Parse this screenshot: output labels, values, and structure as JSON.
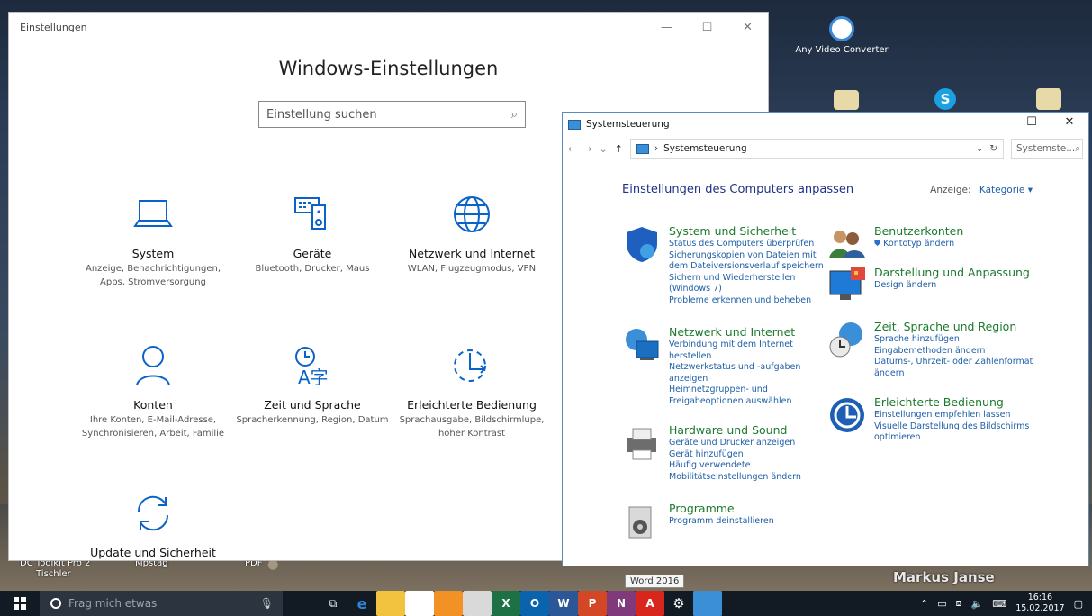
{
  "settings": {
    "title": "Einstellungen",
    "heading": "Windows-Einstellungen",
    "search_placeholder": "Einstellung suchen",
    "tiles": [
      {
        "name": "System",
        "desc": "Anzeige, Benachrichtigungen, Apps, Stromversorgung",
        "icon": "laptop-icon"
      },
      {
        "name": "Geräte",
        "desc": "Bluetooth, Drucker, Maus",
        "icon": "devices-icon"
      },
      {
        "name": "Netzwerk und Internet",
        "desc": "WLAN, Flugzeugmodus, VPN",
        "icon": "globe-icon"
      },
      {
        "name": "Konten",
        "desc": "Ihre Konten, E-Mail-Adresse, Synchronisieren, Arbeit, Familie",
        "icon": "person-icon"
      },
      {
        "name": "Zeit und Sprache",
        "desc": "Spracherkennung, Region, Datum",
        "icon": "time-language-icon"
      },
      {
        "name": "Erleichterte Bedienung",
        "desc": "Sprachausgabe, Bildschirmlupe, hoher Kontrast",
        "icon": "accessibility-icon"
      },
      {
        "name": "Update und Sicherheit",
        "desc": "",
        "icon": "update-icon"
      }
    ]
  },
  "cp": {
    "title": "Systemsteuerung",
    "address": "Systemsteuerung",
    "search": "Systemste...",
    "heading": "Einstellungen des Computers anpassen",
    "view_label": "Anzeige:",
    "view_value": "Kategorie",
    "left": [
      {
        "title": "System und Sicherheit",
        "links": [
          "Status des Computers überprüfen",
          "Sicherungskopien von Dateien mit dem Dateiversionsverlauf speichern",
          "Sichern und Wiederherstellen (Windows 7)",
          "Probleme erkennen und beheben"
        ]
      },
      {
        "title": "Netzwerk und Internet",
        "links": [
          "Verbindung mit dem Internet herstellen",
          "Netzwerkstatus und -aufgaben anzeigen",
          "Heimnetzgruppen- und Freigabeoptionen auswählen"
        ]
      },
      {
        "title": "Hardware und Sound",
        "links": [
          "Geräte und Drucker anzeigen",
          "Gerät hinzufügen",
          "Häufig verwendete Mobilitätseinstellungen ändern"
        ]
      },
      {
        "title": "Programme",
        "links": [
          "Programm deinstallieren"
        ]
      }
    ],
    "right": [
      {
        "title": "Benutzerkonten",
        "links": [
          "Kontotyp ändern"
        ]
      },
      {
        "title": "Darstellung und Anpassung",
        "links": [
          "Design ändern"
        ]
      },
      {
        "title": "Zeit, Sprache und Region",
        "links": [
          "Sprache hinzufügen",
          "Eingabemethoden ändern",
          "Datums-, Uhrzeit- oder Zahlenformat ändern"
        ]
      },
      {
        "title": "Erleichterte Bedienung",
        "links": [
          "Einstellungen empfehlen lassen",
          "Visuelle Darstellung des Bildschirms optimieren"
        ]
      }
    ]
  },
  "desktop": {
    "any_video": "Any Video Converter",
    "owner": "Markus Janse",
    "dc_toolkit": "DC Toolkit Pro 2",
    "tischler": "Tischler",
    "mpstag": "Mpstag",
    "pdf": "PDF"
  },
  "taskbar": {
    "search": "Frag mich etwas",
    "tooltip": "Word 2016",
    "time": "16:16",
    "date": "15.02.2017"
  }
}
